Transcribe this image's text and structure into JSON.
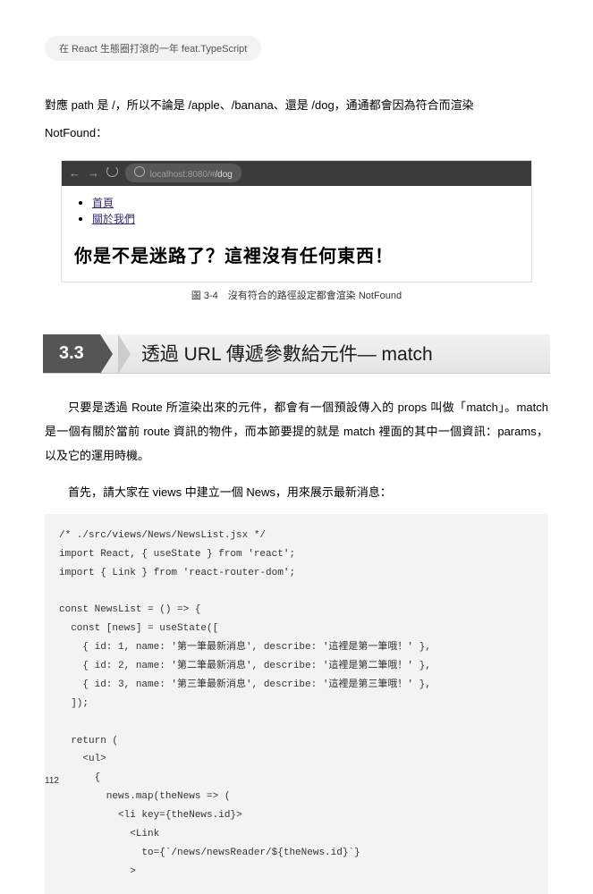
{
  "header_chip": "在 React 生態圈打滾的一年 feat.TypeScript",
  "para1_a": "對應 path 是 /，所以不論是 /apple、/banana、還是 /dog，通通都會因為符合而渲染",
  "para1_b": "NotFound：",
  "browser": {
    "back": "←",
    "forward": "→",
    "url_prefix": "localhost:8080/#",
    "url_path": "/dog",
    "link1": "首頁",
    "link2": "關於我們",
    "message": "你是不是迷路了？這裡沒有任何東西！"
  },
  "figcap": "圖 3-4　沒有符合的路徑設定都會渲染 NotFound",
  "section_num": "3.3",
  "section_title": "透過 URL 傳遞參數給元件— match",
  "para2": "只要是透過 Route 所渲染出來的元件，都會有一個預設傳入的 props 叫做「match」。match 是一個有關於當前 route 資訊的物件，而本節要提的就是 match 裡面的其中一個資訊：params，以及它的運用時機。",
  "para3": "首先，請大家在 views 中建立一個 News，用來展示最新消息：",
  "code": "/* ./src/views/News/NewsList.jsx */\nimport React, { useState } from 'react';\nimport { Link } from 'react-router-dom';\n\nconst NewsList = () => {\n  const [news] = useState([\n    { id: 1, name: '第一筆最新消息', describe: '這裡是第一筆哦！' },\n    { id: 2, name: '第二筆最新消息', describe: '這裡是第二筆哦！' },\n    { id: 3, name: '第三筆最新消息', describe: '這裡是第三筆哦！' },\n  ]);\n\n  return (\n    <ul>\n      {\n        news.map(theNews => (\n          <li key={theNews.id}>\n            <Link\n              to={`/news/newsReader/${theNews.id}`}\n            >",
  "page_num": "112"
}
